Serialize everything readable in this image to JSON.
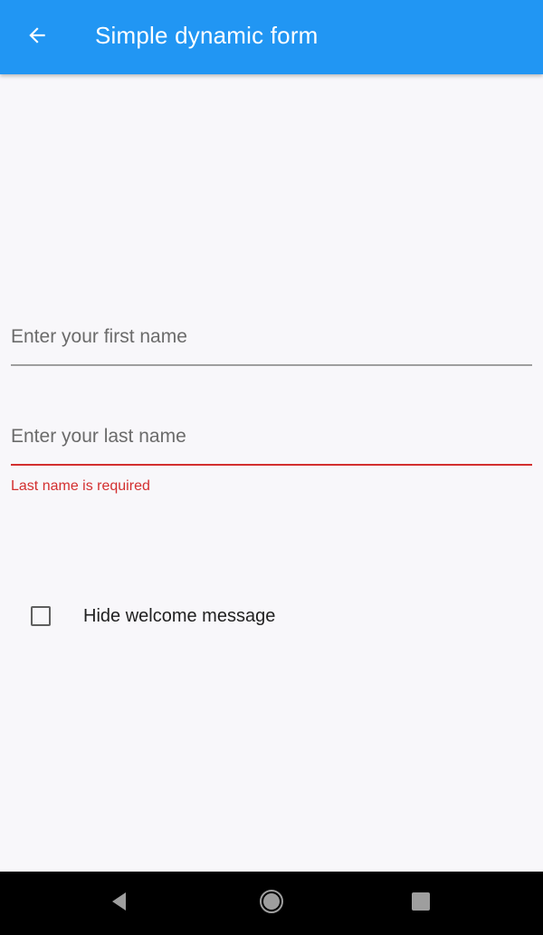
{
  "app_bar": {
    "title": "Simple dynamic form",
    "back_icon": "arrow-left-icon",
    "color": "#2196f3"
  },
  "form": {
    "first_name": {
      "value": "",
      "placeholder": "Enter your first name"
    },
    "last_name": {
      "value": "",
      "placeholder": "Enter your last name",
      "error": "Last name is required",
      "error_color": "#d32f2f"
    },
    "hide_welcome": {
      "label": "Hide welcome message",
      "checked": false
    }
  },
  "system_nav": {
    "back_icon": "triangle-back-icon",
    "home_icon": "circle-home-icon",
    "recents_icon": "square-recents-icon"
  }
}
